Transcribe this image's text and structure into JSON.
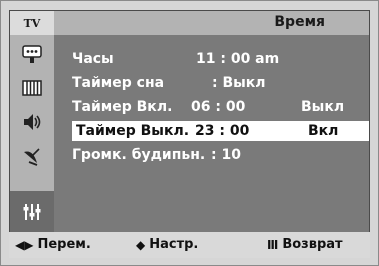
{
  "sidebar": {
    "top_label": "TV",
    "icons": [
      "input-icon",
      "picture-icon",
      "sound-icon",
      "channel-icon",
      "setup-icon"
    ]
  },
  "header": {
    "title": "Время"
  },
  "rows": [
    {
      "label": "Часы",
      "value": "11 : 00 am",
      "extra": ""
    },
    {
      "label": "Таймер сна",
      "value": ": Выкл",
      "extra": ""
    },
    {
      "label": "Таймер Вкл.",
      "value": "06 : 00",
      "extra": "Выкл"
    },
    {
      "label": "Таймер Выкл.",
      "value": "23 : 00",
      "extra": "Вкл"
    },
    {
      "label": "Громк. будипьн.",
      "value": ": 10",
      "extra": ""
    }
  ],
  "footer": {
    "move_label": "Перем.",
    "adjust_label": "Настр.",
    "return_label": "Возврат"
  },
  "colors": {
    "panel": "#7a7a7a",
    "sidebar": "#b3b3b3",
    "selected_row": "#ffffff",
    "text": "#ffffff"
  }
}
